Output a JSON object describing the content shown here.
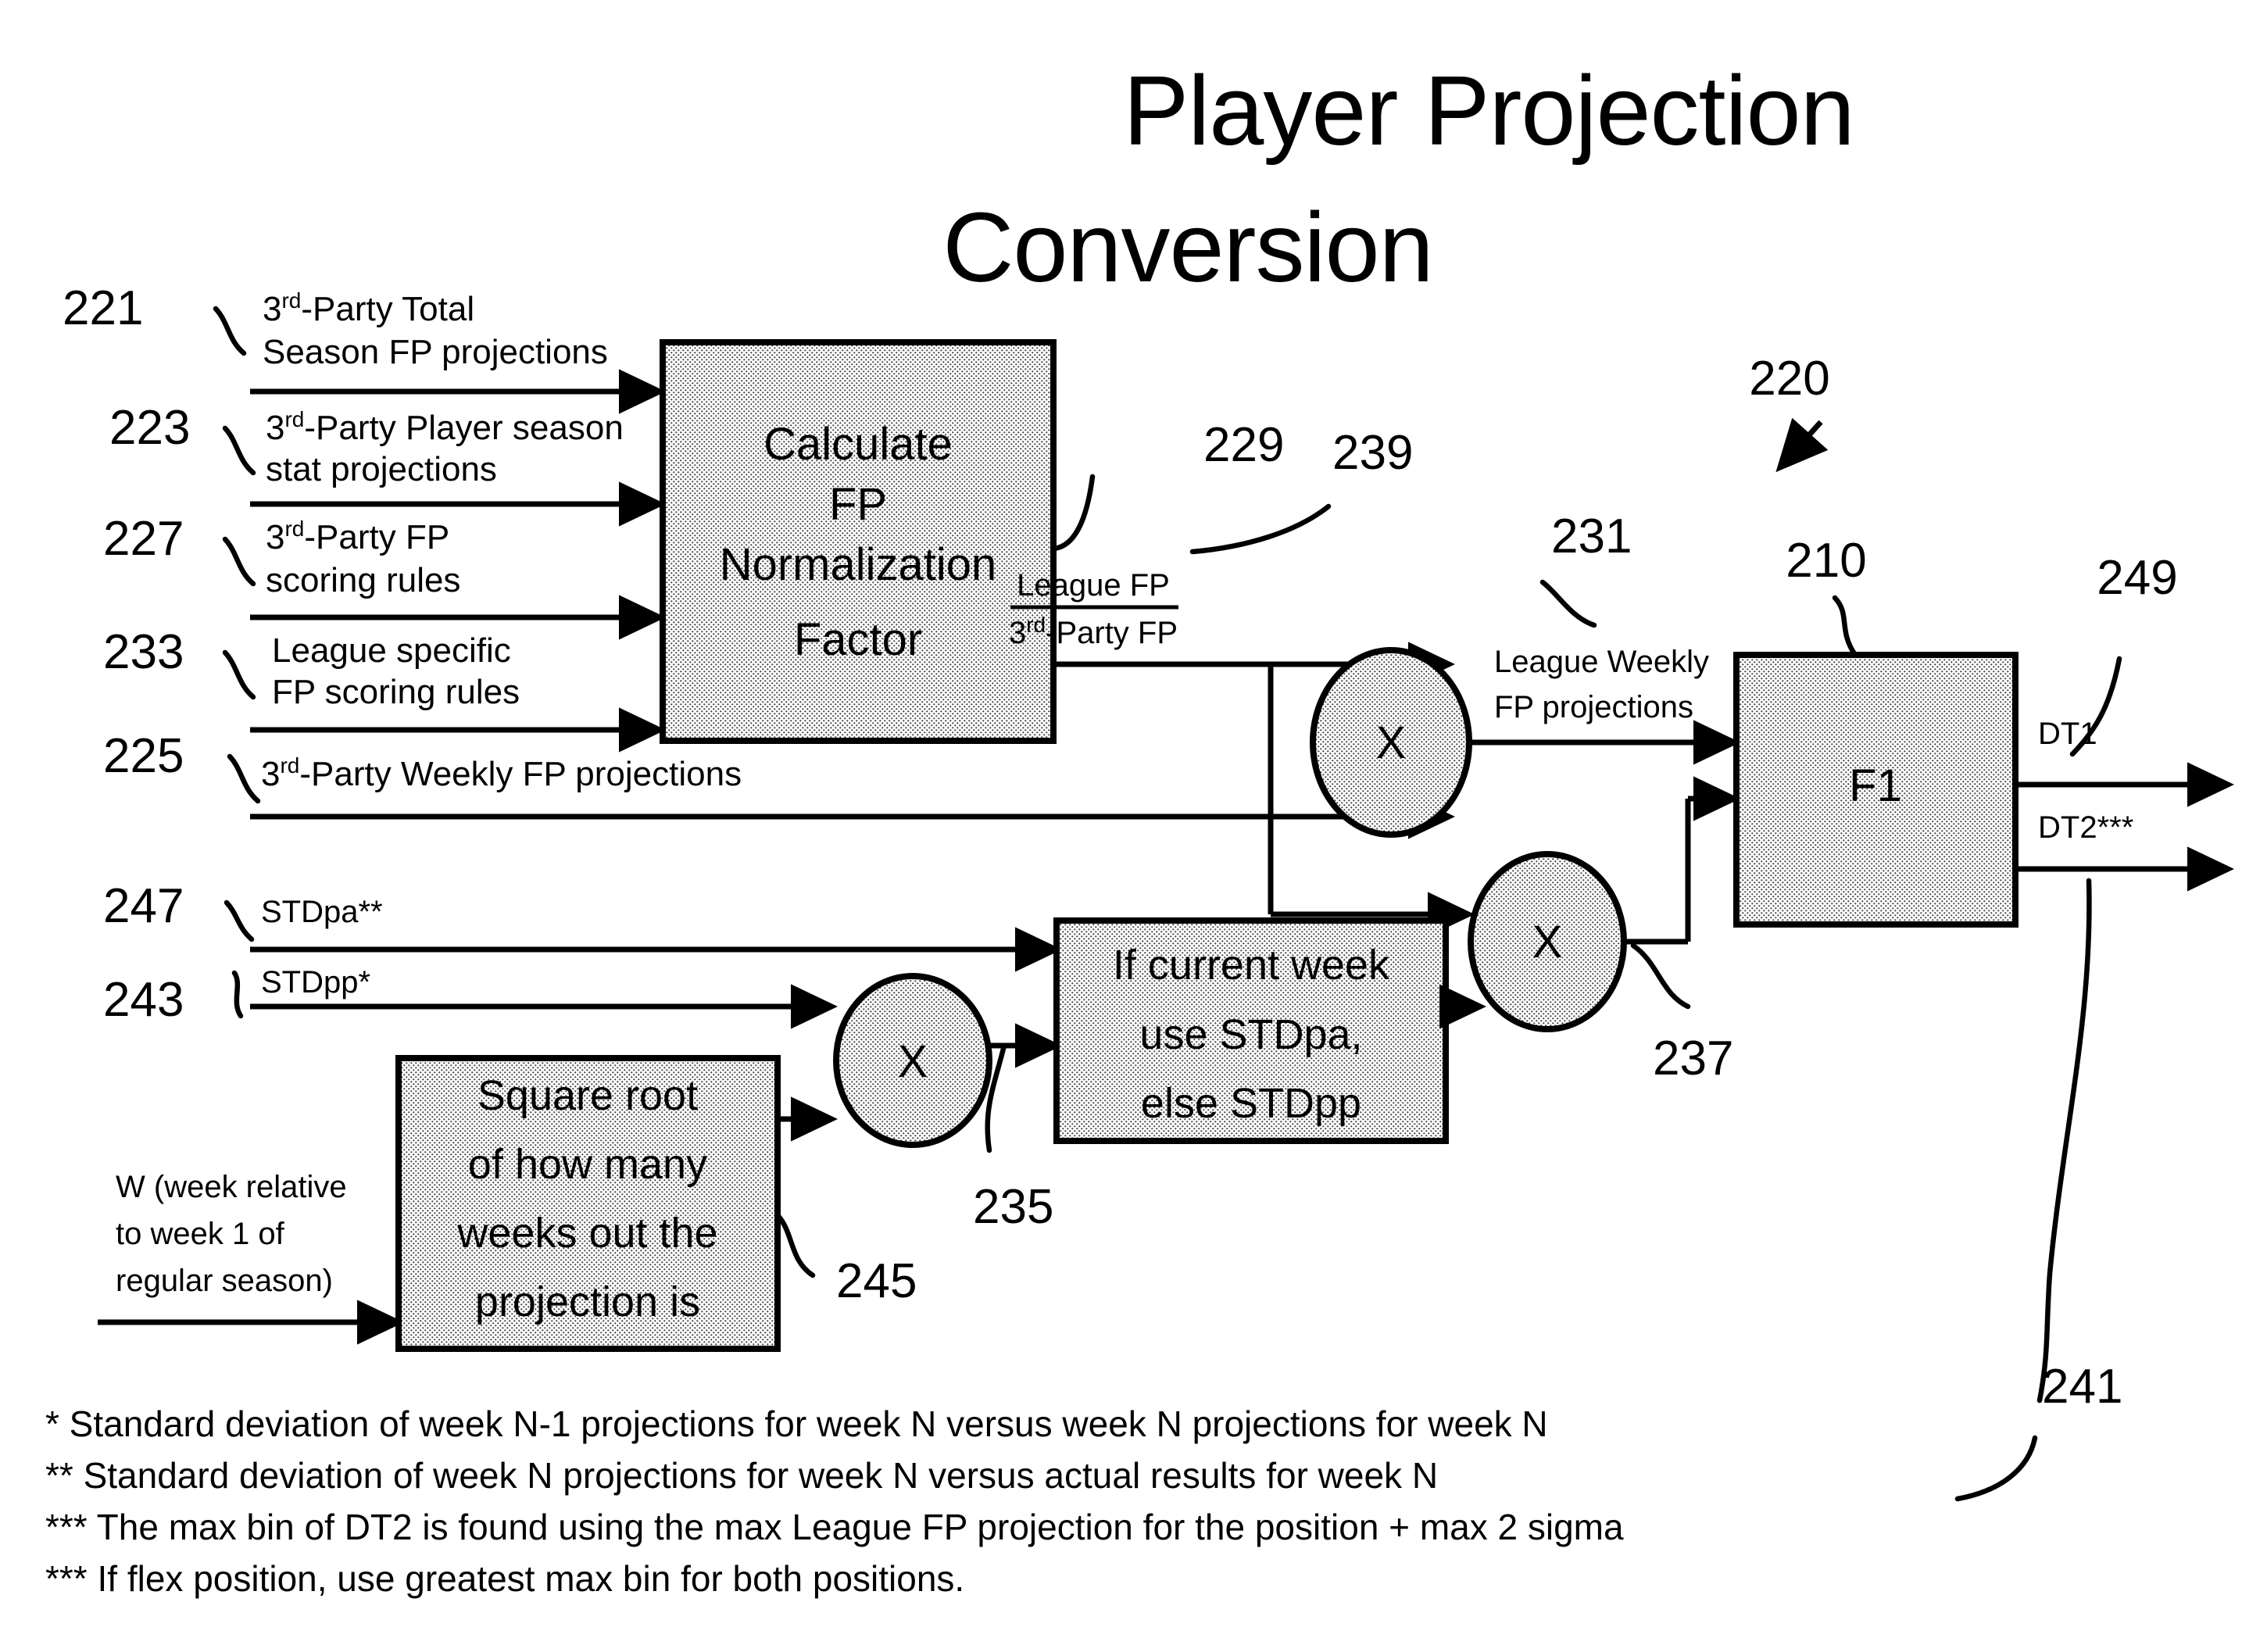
{
  "title": {
    "line1": "Player Projection",
    "line2": "Conversion"
  },
  "reference_numbers": {
    "r221": "221",
    "r223": "223",
    "r227": "227",
    "r233": "233",
    "r225": "225",
    "r229": "229",
    "r239": "239",
    "r231": "231",
    "r220": "220",
    "r210": "210",
    "r249": "249",
    "r247": "247",
    "r243": "243",
    "r245": "245",
    "r235": "235",
    "r237": "237",
    "r241": "241"
  },
  "inputs": {
    "i221_l1_pre": "3",
    "i221_l1_sup": "rd",
    "i221_l1_post": "-Party Total",
    "i221_l2": "Season FP projections",
    "i223_l1_pre": "3",
    "i223_l1_sup": "rd",
    "i223_l1_post": "-Party Player season",
    "i223_l2": "stat projections",
    "i227_l1_pre": "3",
    "i227_l1_sup": "rd",
    "i227_l1_post": "-Party  FP",
    "i227_l2": "scoring rules",
    "i233_l1": "League specific",
    "i233_l2": "FP scoring rules",
    "i225_pre": "3",
    "i225_sup": "rd",
    "i225_post": "-Party Weekly FP projections",
    "i247": "STDpa**",
    "i243": "STDpp*",
    "iW_l1": "W (week relative",
    "iW_l2": "to week 1 of",
    "iW_l3": "regular season)"
  },
  "nodes": {
    "normalization_box": {
      "l1": "Calculate",
      "l2": "FP",
      "l3": "Normalization",
      "l4": "Factor"
    },
    "sqrt_box": {
      "l1": "Square root",
      "l2": "of how many",
      "l3": "weeks out the",
      "l4": "projection is"
    },
    "std_select_box": {
      "l1": "If current week",
      "l2": "use STDpa,",
      "l3": "else STDpp"
    },
    "f1_box": {
      "label": "F1"
    },
    "multiplier_1": "X",
    "multiplier_2": "X",
    "multiplier_3": "X"
  },
  "edge_labels": {
    "ratio_numerator": "League FP",
    "ratio_denominator_pre": "3",
    "ratio_denominator_sup": "rd",
    "ratio_denominator_post": "-Party FP",
    "league_weekly_l1": "League Weekly",
    "league_weekly_l2": "FP projections",
    "dt1": "DT1",
    "dt2": "DT2***"
  },
  "footnotes": [
    "* Standard deviation of week N-1 projections for week N versus week N projections for week N",
    "** Standard deviation of week N projections for week N versus actual results for week N",
    "*** The max bin of DT2 is found using the max League FP projection for the position + max 2 sigma",
    "*** If flex position, use greatest max bin for both positions."
  ],
  "colors": {
    "stroke": "#000000",
    "fill_pattern": "#e8e8e8",
    "background": "#ffffff"
  }
}
